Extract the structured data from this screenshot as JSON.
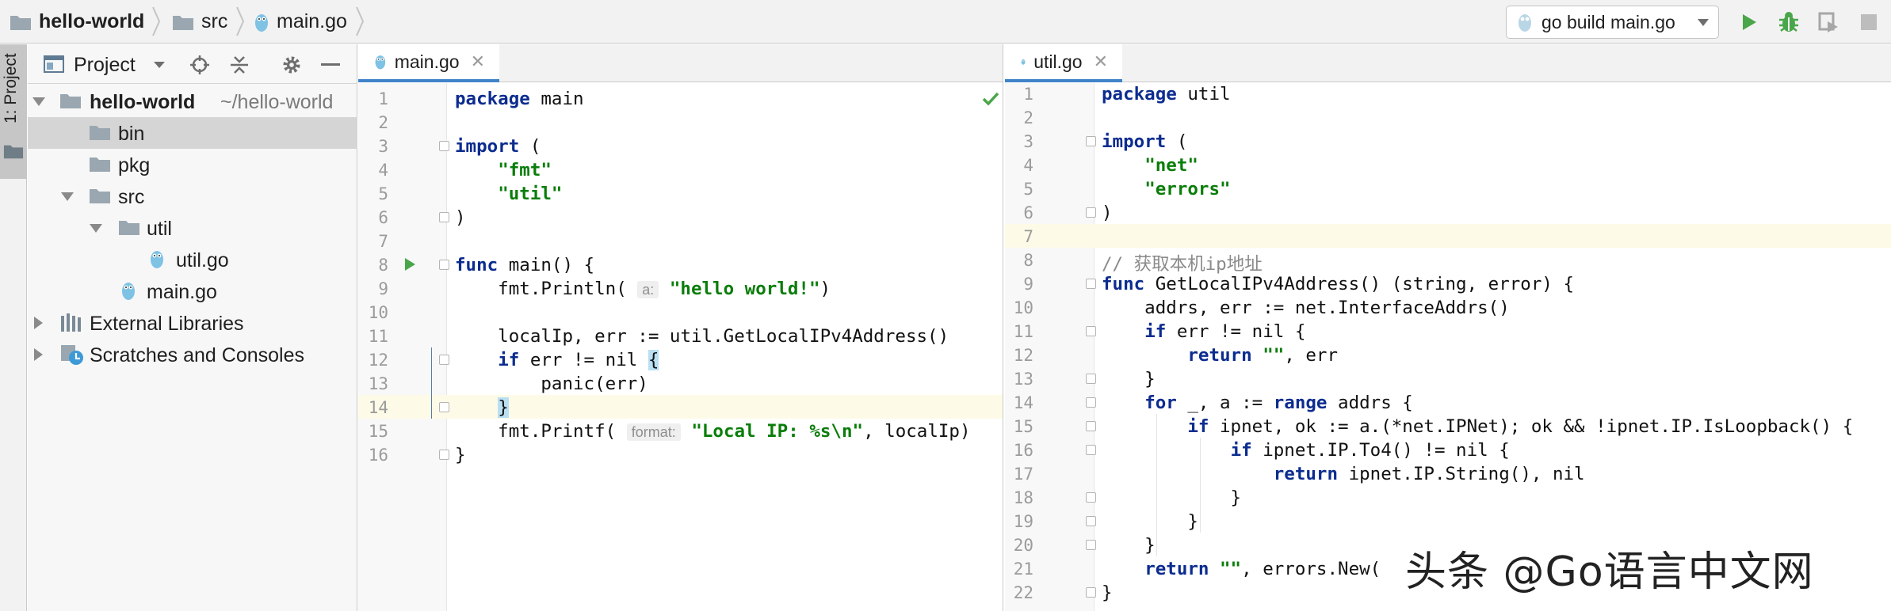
{
  "navbar": {
    "breadcrumbs": [
      {
        "label": "hello-world",
        "icon": "folder-icon"
      },
      {
        "label": "src",
        "icon": "folder-icon"
      },
      {
        "label": "main.go",
        "icon": "go-file-icon"
      }
    ],
    "run_config": "go build main.go",
    "actions": [
      "run-icon",
      "debug-icon",
      "coverage-icon",
      "stop-icon"
    ]
  },
  "stripe": {
    "label": "1: Project"
  },
  "project_panel": {
    "title": "Project",
    "tree": [
      {
        "name": "hello-world",
        "suffix": "~/hello-world",
        "icon": "folder-icon",
        "expanded": true
      },
      {
        "name": "bin",
        "icon": "folder-icon",
        "selected": true
      },
      {
        "name": "pkg",
        "icon": "folder-icon"
      },
      {
        "name": "src",
        "icon": "folder-icon",
        "expanded": true
      },
      {
        "name": "util",
        "icon": "folder-icon",
        "expanded": true
      },
      {
        "name": "util.go",
        "icon": "go-file-icon"
      },
      {
        "name": "main.go",
        "icon": "go-file-icon"
      },
      {
        "name": "External Libraries",
        "icon": "libraries-icon"
      },
      {
        "name": "Scratches and Consoles",
        "icon": "scratches-icon"
      }
    ]
  },
  "editor_left": {
    "tab": "main.go",
    "lines": [
      {
        "n": "1",
        "t": [
          [
            "kw",
            "package"
          ],
          [
            "",
            " main"
          ]
        ]
      },
      {
        "n": "2",
        "t": []
      },
      {
        "n": "3",
        "t": [
          [
            "kw",
            "import"
          ],
          [
            "",
            " ("
          ]
        ]
      },
      {
        "n": "4",
        "t": [
          [
            "",
            "    "
          ],
          [
            "str",
            "\"fmt\""
          ]
        ]
      },
      {
        "n": "5",
        "t": [
          [
            "",
            "    "
          ],
          [
            "str",
            "\"util\""
          ]
        ]
      },
      {
        "n": "6",
        "t": [
          [
            "",
            ")"
          ]
        ]
      },
      {
        "n": "7",
        "t": []
      },
      {
        "n": "8",
        "t": [
          [
            "kw",
            "func"
          ],
          [
            "",
            " main() {"
          ]
        ]
      },
      {
        "n": "9",
        "t": [
          [
            "",
            "    fmt.Println( "
          ],
          [
            "hint",
            "a:"
          ],
          [
            "",
            " "
          ],
          [
            "str",
            "\"hello world!\""
          ],
          [
            "",
            ")"
          ]
        ]
      },
      {
        "n": "10",
        "t": []
      },
      {
        "n": "11",
        "t": [
          [
            "",
            "    localIp, err := util.GetLocalIPv4Address()"
          ]
        ]
      },
      {
        "n": "12",
        "t": [
          [
            "",
            "    "
          ],
          [
            "kw",
            "if"
          ],
          [
            "",
            " err != nil "
          ],
          [
            "brace",
            "{"
          ]
        ]
      },
      {
        "n": "13",
        "t": [
          [
            "",
            "        panic(err)"
          ]
        ]
      },
      {
        "n": "14",
        "t": [
          [
            "",
            "    "
          ],
          [
            "brace",
            "}"
          ]
        ]
      },
      {
        "n": "15",
        "t": [
          [
            "",
            "    fmt.Printf( "
          ],
          [
            "hint",
            "format:"
          ],
          [
            "",
            " "
          ],
          [
            "str",
            "\"Local IP: %s\\n\""
          ],
          [
            "",
            ", localIp)"
          ]
        ]
      },
      {
        "n": "16",
        "t": [
          [
            "",
            "}"
          ]
        ]
      }
    ]
  },
  "editor_right": {
    "tab": "util.go",
    "lines": [
      {
        "n": "1",
        "t": [
          [
            "kw",
            "package"
          ],
          [
            "",
            " util"
          ]
        ]
      },
      {
        "n": "2",
        "t": []
      },
      {
        "n": "3",
        "t": [
          [
            "kw",
            "import"
          ],
          [
            "",
            " ("
          ]
        ]
      },
      {
        "n": "4",
        "t": [
          [
            "",
            "    "
          ],
          [
            "str",
            "\"net\""
          ]
        ]
      },
      {
        "n": "5",
        "t": [
          [
            "",
            "    "
          ],
          [
            "str",
            "\"errors\""
          ]
        ]
      },
      {
        "n": "6",
        "t": [
          [
            "",
            ")"
          ]
        ]
      },
      {
        "n": "7",
        "t": []
      },
      {
        "n": "8",
        "t": [
          [
            "cmt",
            "// 获取本机ip地址"
          ]
        ]
      },
      {
        "n": "9",
        "t": [
          [
            "kw",
            "func"
          ],
          [
            "",
            " GetLocalIPv4Address() (string, error) {"
          ]
        ]
      },
      {
        "n": "10",
        "t": [
          [
            "",
            "    addrs, err := net.InterfaceAddrs()"
          ]
        ]
      },
      {
        "n": "11",
        "t": [
          [
            "",
            "    "
          ],
          [
            "kw",
            "if"
          ],
          [
            "",
            " err != nil {"
          ]
        ]
      },
      {
        "n": "12",
        "t": [
          [
            "",
            "        "
          ],
          [
            "kw",
            "return"
          ],
          [
            "",
            " "
          ],
          [
            "str",
            "\"\""
          ],
          [
            "",
            ", err"
          ]
        ]
      },
      {
        "n": "13",
        "t": [
          [
            "",
            "    }"
          ]
        ]
      },
      {
        "n": "14",
        "t": [
          [
            "",
            "    "
          ],
          [
            "kw",
            "for"
          ],
          [
            "",
            " _, a := "
          ],
          [
            "kw",
            "range"
          ],
          [
            "",
            " addrs {"
          ]
        ]
      },
      {
        "n": "15",
        "t": [
          [
            "",
            "        "
          ],
          [
            "kw",
            "if"
          ],
          [
            "",
            " ipnet, ok := a.(*net.IPNet); ok && !ipnet.IP.IsLoopback() {"
          ]
        ]
      },
      {
        "n": "16",
        "t": [
          [
            "",
            "            "
          ],
          [
            "kw",
            "if"
          ],
          [
            "",
            " ipnet.IP.To4() != nil {"
          ]
        ]
      },
      {
        "n": "17",
        "t": [
          [
            "",
            "                "
          ],
          [
            "kw",
            "return"
          ],
          [
            "",
            " ipnet.IP.String(), nil"
          ]
        ]
      },
      {
        "n": "18",
        "t": [
          [
            "",
            "            }"
          ]
        ]
      },
      {
        "n": "19",
        "t": [
          [
            "",
            "        }"
          ]
        ]
      },
      {
        "n": "20",
        "t": [
          [
            "",
            "    }"
          ]
        ]
      },
      {
        "n": "21",
        "t": [
          [
            "",
            "    "
          ],
          [
            "kw",
            "return"
          ],
          [
            "",
            " "
          ],
          [
            "str",
            "\"\""
          ],
          [
            "",
            ", errors.New("
          ]
        ]
      },
      {
        "n": "22",
        "t": [
          [
            "",
            "}"
          ]
        ]
      }
    ]
  },
  "watermark": "头条 @Go语言中文网",
  "colors": {
    "keyword": "#0c2c8f",
    "string": "#0a7d0a",
    "accent": "#4083c9",
    "run": "#4aa64a"
  }
}
